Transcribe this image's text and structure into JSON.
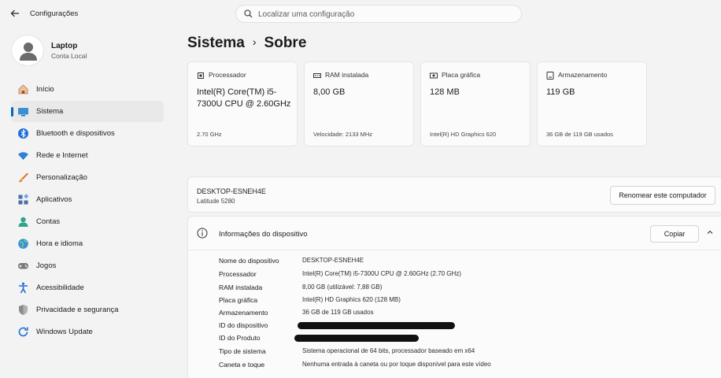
{
  "window": {
    "title": "Configurações"
  },
  "search": {
    "placeholder": "Localizar uma configuração"
  },
  "profile": {
    "name": "Laptop",
    "account": "Conta Local"
  },
  "sidebar": {
    "items": [
      {
        "label": "Início",
        "icon": "home-icon"
      },
      {
        "label": "Sistema",
        "icon": "system-icon",
        "active": true
      },
      {
        "label": "Bluetooth e dispositivos",
        "icon": "bluetooth-icon"
      },
      {
        "label": "Rede e Internet",
        "icon": "wifi-icon"
      },
      {
        "label": "Personalização",
        "icon": "brush-icon"
      },
      {
        "label": "Aplicativos",
        "icon": "apps-icon"
      },
      {
        "label": "Contas",
        "icon": "accounts-icon"
      },
      {
        "label": "Hora e idioma",
        "icon": "globe-icon"
      },
      {
        "label": "Jogos",
        "icon": "gamepad-icon"
      },
      {
        "label": "Acessibilidade",
        "icon": "accessibility-icon"
      },
      {
        "label": "Privacidade e segurança",
        "icon": "shield-icon"
      },
      {
        "label": "Windows Update",
        "icon": "update-icon"
      }
    ]
  },
  "breadcrumb": {
    "parent": "Sistema",
    "separator": "›",
    "current": "Sobre"
  },
  "cards": [
    {
      "label": "Processador",
      "value": "Intel(R) Core(TM) i5-7300U CPU @ 2.60GHz",
      "detail": "2.70 GHz",
      "icon": "cpu-icon"
    },
    {
      "label": "RAM instalada",
      "value": "8,00 GB",
      "detail": "Velocidade: 2133 MHz",
      "icon": "ram-icon"
    },
    {
      "label": "Placa gráfica",
      "value": "128 MB",
      "detail": "Intel(R) HD Graphics 620",
      "icon": "gpu-icon"
    },
    {
      "label": "Armazenamento",
      "value": "119 GB",
      "detail": "36 GB de 119 GB usados",
      "icon": "storage-icon"
    }
  ],
  "device": {
    "name": "DESKTOP-ESNEH4E",
    "model": "Latitude 5280",
    "rename_label": "Renomear este computador"
  },
  "device_info": {
    "title": "Informações do dispositivo",
    "copy_label": "Copiar",
    "rows": [
      {
        "key": "Nome do dispositivo",
        "value": "DESKTOP-ESNEH4E"
      },
      {
        "key": "Processador",
        "value": "Intel(R) Core(TM) i5-7300U CPU @ 2.60GHz (2.70 GHz)"
      },
      {
        "key": "RAM instalada",
        "value": "8,00 GB (utilizável: 7,88 GB)"
      },
      {
        "key": "Placa gráfica",
        "value": "Intel(R) HD Graphics 620 (128 MB)"
      },
      {
        "key": "Armazenamento",
        "value": "36 GB de 119 GB usados"
      },
      {
        "key": "ID do dispositivo",
        "value": "",
        "redacted": true
      },
      {
        "key": "ID do Produto",
        "value": "",
        "redacted": true
      },
      {
        "key": "Tipo de sistema",
        "value": "Sistema operacional de 64 bits, processador baseado em x64"
      },
      {
        "key": "Caneta e toque",
        "value": "Nenhuma entrada à caneta ou por toque disponível para este vídeo"
      }
    ]
  },
  "colors": {
    "accent": "#0067c0",
    "background": "#f3f3f3",
    "card": "#fbfbfb"
  }
}
